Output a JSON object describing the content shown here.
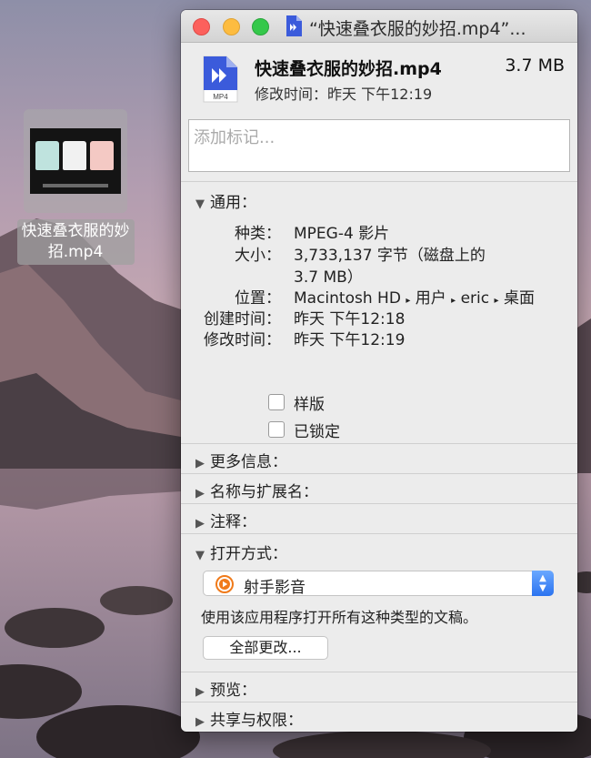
{
  "desktop": {
    "file_label_line1": "快速叠衣服的妙",
    "file_label_line2": "招.mp4"
  },
  "window": {
    "title": "“快速叠衣服的妙招.mp4”...",
    "file_name": "快速叠衣服的妙招.mp4",
    "file_size": "3.7 MB",
    "modified_summary": "修改时间：昨天 下午12:19",
    "file_icon_badge": "MP4",
    "tags_placeholder": "添加标记..."
  },
  "general": {
    "header": "通用：",
    "kind_label": "种类：",
    "kind_value": "MPEG-4 影片",
    "size_label": "大小：",
    "size_value_1": "3,733,137 字节（磁盘上的",
    "size_value_2": "3.7 MB）",
    "where_label": "位置：",
    "where_parts": [
      "Macintosh HD",
      "用户",
      "eric",
      "桌面"
    ],
    "created_label": "创建时间：",
    "created_value": "昨天 下午12:18",
    "modified_label": "修改时间：",
    "modified_value": "昨天 下午12:19",
    "stationery_label": "样版",
    "locked_label": "已锁定"
  },
  "sections": {
    "more_info": "更多信息：",
    "name_ext": "名称与扩展名：",
    "comments": "注释：",
    "open_with": "打开方式：",
    "preview": "预览：",
    "sharing": "共享与权限："
  },
  "open_with": {
    "app": "射手影音",
    "description": "使用该应用程序打开所有这种类型的文稿。",
    "change_all": "全部更改..."
  },
  "colors": {
    "accent_blue": "#2b73f0",
    "traffic_red": "#fc605c",
    "traffic_yellow": "#fdbc40",
    "traffic_green": "#34c84a",
    "file_icon_blue": "#3b5bdb"
  }
}
